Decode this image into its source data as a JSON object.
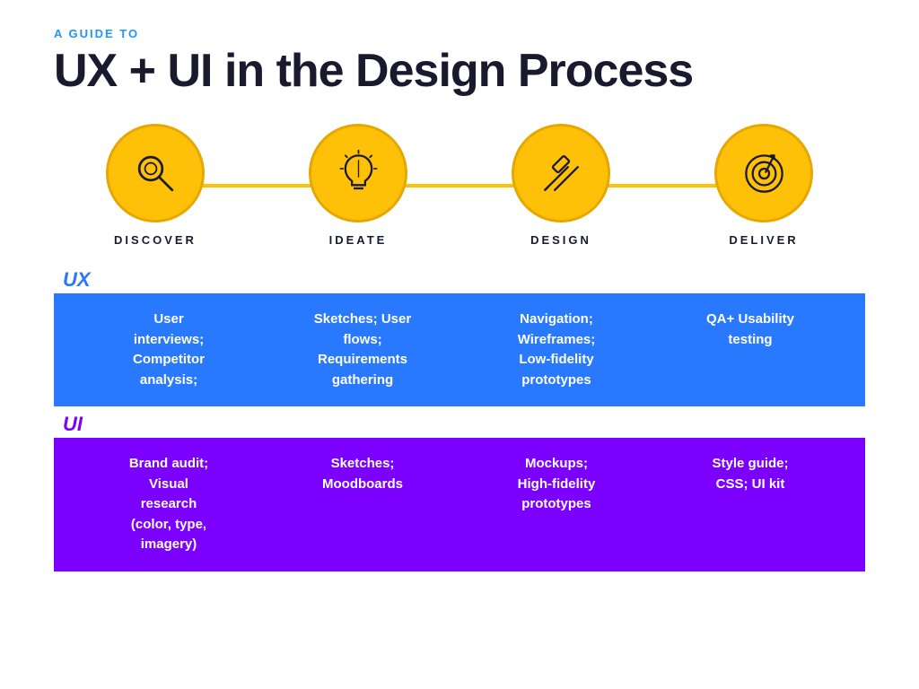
{
  "header": {
    "subtitle": "A GUIDE TO",
    "title": "UX + UI in the Design Process"
  },
  "steps": [
    {
      "id": "discover",
      "label": "DISCOVER",
      "icon": "search"
    },
    {
      "id": "ideate",
      "label": "IDEATE",
      "icon": "lightbulb"
    },
    {
      "id": "design",
      "label": "DESIGN",
      "icon": "pencil-ruler"
    },
    {
      "id": "deliver",
      "label": "DELIVER",
      "icon": "target"
    }
  ],
  "ux": {
    "label": "UX",
    "cells": [
      "User\ninterviews;\nCompetitor\nanalysis;",
      "Sketches; User\nflows;\nRequirements\ngathering",
      "Navigation;\nWireframes;\nLow-fidelity\nprototypes",
      "QA+ Usability\ntesting"
    ]
  },
  "ui": {
    "label": "UI",
    "cells": [
      "Brand audit;\nVisual\nresearch\n(color, type,\nimagery)",
      "Sketches;\nMoodboards",
      "Mockups;\nHigh-fidelity\nprototypes",
      "Style guide;\nCSS; UI kit"
    ]
  },
  "colors": {
    "blue_accent": "#2196F3",
    "yellow": "#FFC107",
    "dark": "#1a1a2e",
    "blue_bg": "#2979FF",
    "purple_bg": "#7B00FF"
  }
}
